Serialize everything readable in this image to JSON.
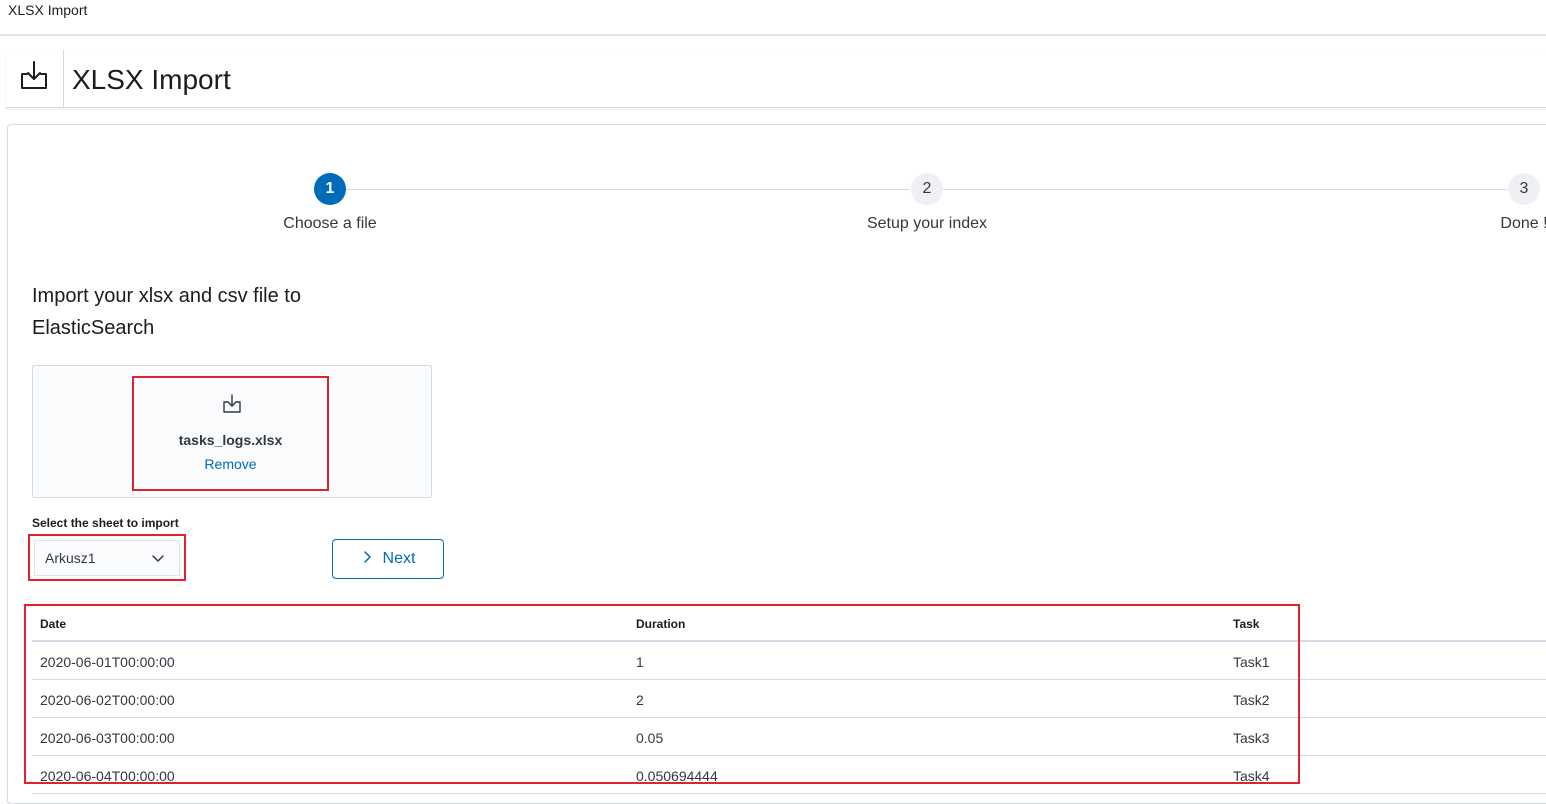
{
  "browser": {
    "tab_title": "XLSX Import"
  },
  "header": {
    "title": "XLSX Import",
    "icon": "import-icon"
  },
  "steps": [
    {
      "number": "1",
      "label": "Choose a file",
      "state": "active"
    },
    {
      "number": "2",
      "label": "Setup your index",
      "state": "inactive"
    },
    {
      "number": "3",
      "label": "Done !",
      "state": "inactive"
    }
  ],
  "import_heading": "Import your xlsx and csv file to ElasticSearch",
  "file_picker": {
    "icon": "import-icon",
    "file_name": "tasks_logs.xlsx",
    "remove_label": "Remove"
  },
  "sheet_select": {
    "label": "Select the sheet to import",
    "value": "Arkusz1"
  },
  "next_button": {
    "label": "Next",
    "icon": "chevron-right-icon"
  },
  "table": {
    "columns": [
      "Date",
      "Duration",
      "Task"
    ],
    "rows": [
      [
        "2020-06-01T00:00:00",
        "1",
        "Task1"
      ],
      [
        "2020-06-02T00:00:00",
        "2",
        "Task2"
      ],
      [
        "2020-06-03T00:00:00",
        "0.05",
        "Task3"
      ],
      [
        "2020-06-04T00:00:00",
        "0.050694444",
        "Task4"
      ]
    ]
  },
  "colors": {
    "primary": "#006bb8",
    "highlight": "#e0212e",
    "border": "#d3dae6"
  }
}
